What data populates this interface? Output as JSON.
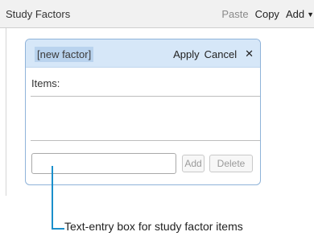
{
  "panel": {
    "title": "Study Factors",
    "actions": {
      "paste": "Paste",
      "copy": "Copy",
      "add": "Add"
    }
  },
  "dialog": {
    "factor_name": "[new factor]",
    "apply": "Apply",
    "cancel": "Cancel",
    "close": "✕",
    "items_label": "Items:",
    "entry_value": "",
    "add_button": "Add",
    "delete_button": "Delete"
  },
  "callout": {
    "text": "Text-entry box for study factor items"
  },
  "colors": {
    "accent": "#1b8fcb",
    "dialog_bar": "#d6e7f8",
    "dialog_border": "#8fb3d9",
    "disabled_text": "#9a9a9a"
  },
  "icons": {
    "close": "close-icon",
    "dropdown": "chevron-down-icon"
  }
}
